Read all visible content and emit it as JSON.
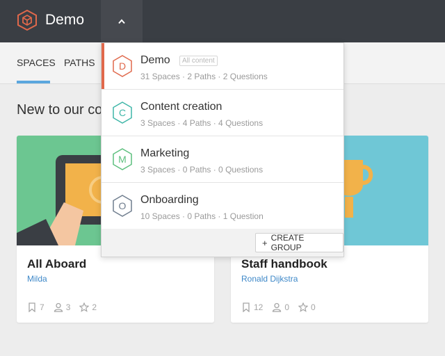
{
  "header": {
    "app_name": "Demo",
    "logo_icon": "cube-hexagon-icon",
    "toggle_icon": "chevron-up-icon",
    "brand_color": "#e0684b"
  },
  "nav": {
    "tabs": [
      {
        "label": "SPACES",
        "active": true
      },
      {
        "label": "PATHS",
        "active": false
      }
    ],
    "active_color": "#5ba7de"
  },
  "section": {
    "title": "New to our co"
  },
  "cards": [
    {
      "title": "All Aboard",
      "author": "Milda",
      "bookmarks": "7",
      "members": "3",
      "stars": "2",
      "image_color": "#6cc691"
    },
    {
      "title": "Staff handbook",
      "author": "Ronald Dijkstra",
      "bookmarks": "12",
      "members": "0",
      "stars": "0",
      "image_color": "#6fc7d6"
    }
  ],
  "groups_dropdown": {
    "items": [
      {
        "letter": "D",
        "name": "Demo",
        "badge": "All content",
        "meta": "31 Spaces · 2 Paths · 2 Questions",
        "color": "#e0684b",
        "active": true
      },
      {
        "letter": "C",
        "name": "Content creation",
        "badge": "",
        "meta": "3 Spaces · 4 Paths · 4 Questions",
        "color": "#3fb6a8",
        "active": false
      },
      {
        "letter": "M",
        "name": "Marketing",
        "badge": "",
        "meta": "3 Spaces · 0 Paths · 0 Questions",
        "color": "#5cbf7d",
        "active": false
      },
      {
        "letter": "O",
        "name": "Onboarding",
        "badge": "",
        "meta": "10 Spaces · 0 Paths · 1 Question",
        "color": "#6f7d8e",
        "active": false
      }
    ],
    "create_label": "CREATE GROUP",
    "create_icon": "+"
  }
}
